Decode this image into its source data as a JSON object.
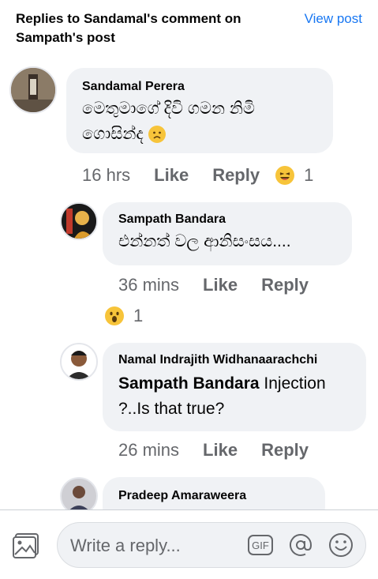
{
  "header": {
    "title": "Replies to Sandamal's comment on Sampath's post",
    "view_post": "View post"
  },
  "comments": [
    {
      "author": "Sandamal Perera",
      "text": "මෙතුමාගේ දිවි ගමන නිමි ගොසින්ද",
      "time": "16 hrs",
      "like": "Like",
      "reply": "Reply",
      "reaction_icon": "laughing-emoji",
      "reaction_count": "1"
    },
    {
      "author": "Sampath Bandara",
      "text": "එන්නත් වල ආනිසංසය....",
      "time": "36 mins",
      "like": "Like",
      "reply": "Reply",
      "reaction_icon": "wow-emoji",
      "reaction_count": "1"
    },
    {
      "author": "Namal Indrajith Widhanaarachchi",
      "mention": "Sampath Bandara",
      "text": "Injection ?..Is that true?",
      "time": "26 mins",
      "like": "Like",
      "reply": "Reply"
    },
    {
      "author": "Pradeep Amaraweera"
    }
  ],
  "composer": {
    "placeholder": "Write a reply...",
    "gif_label": "GIF",
    "icons": [
      "photo-icon",
      "gif-icon",
      "mention-icon",
      "emoji-icon"
    ]
  },
  "colors": {
    "accent": "#1877f2",
    "bubble": "#f0f2f5",
    "meta": "#65676b",
    "emoji": "#f7c43a"
  }
}
